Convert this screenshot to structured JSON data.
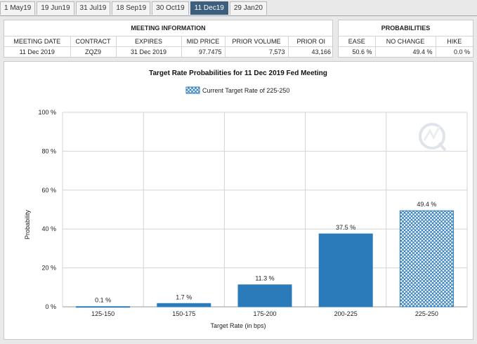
{
  "tabs": [
    {
      "label": "1 May19",
      "active": false
    },
    {
      "label": "19 Jun19",
      "active": false
    },
    {
      "label": "31 Jul19",
      "active": false
    },
    {
      "label": "18 Sep19",
      "active": false
    },
    {
      "label": "30 Oct19",
      "active": false
    },
    {
      "label": "11 Dec19",
      "active": true
    },
    {
      "label": "29 Jan20",
      "active": false
    }
  ],
  "meeting_info": {
    "header": "MEETING INFORMATION",
    "columns": [
      "MEETING DATE",
      "CONTRACT",
      "EXPIRES",
      "MID PRICE",
      "PRIOR VOLUME",
      "PRIOR OI"
    ],
    "row": [
      "11 Dec 2019",
      "ZQZ9",
      "31 Dec 2019",
      "97.7475",
      "7,573",
      "43,166"
    ]
  },
  "probabilities": {
    "header": "PROBABILITIES",
    "columns": [
      "EASE",
      "NO CHANGE",
      "HIKE"
    ],
    "row": [
      "50.6 %",
      "49.4 %",
      "0.0 %"
    ]
  },
  "colors": {
    "bar": "#2b7bba",
    "tab_active": "#3b5f7c"
  },
  "chart_data": {
    "type": "bar",
    "title": "Target Rate Probabilities for 11 Dec 2019 Fed Meeting",
    "legend": "Current Target Rate of 225-250",
    "legend_position": "top-center",
    "xlabel": "Target Rate (in bps)",
    "ylabel": "Probability",
    "categories": [
      "125-150",
      "150-175",
      "175-200",
      "200-225",
      "225-250"
    ],
    "values": [
      0.1,
      1.7,
      11.3,
      37.5,
      49.4
    ],
    "data_labels": [
      "0.1 %",
      "1.7 %",
      "11.3 %",
      "37.5 %",
      "49.4 %"
    ],
    "highlighted_category": "225-250",
    "ylim": [
      0,
      100
    ],
    "yticks": [
      0,
      20,
      40,
      60,
      80,
      100
    ],
    "ytick_labels": [
      "0 %",
      "20 %",
      "40 %",
      "60 %",
      "80 %",
      "100 %"
    ],
    "grid": true
  }
}
